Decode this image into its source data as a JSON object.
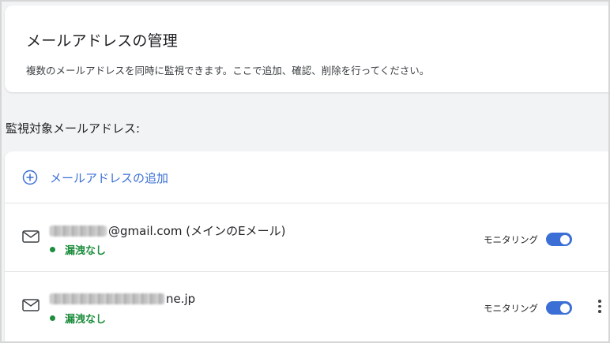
{
  "header": {
    "title": "メールアドレスの管理",
    "description": "複数のメールアドレスを同時に監視できます。ここで追加、確認、削除を行ってください。"
  },
  "section": {
    "heading": "監視対象メールアドレス:"
  },
  "add_button": {
    "label": "メールアドレスの追加",
    "icon": "plus-circle-icon"
  },
  "emails": [
    {
      "address_visible": "@gmail.com (メインのEメール)",
      "status": "漏洩なし",
      "monitor_label": "モニタリング",
      "monitoring": true,
      "icon": "mail-icon"
    },
    {
      "address_visible": "ne.jp",
      "status": "漏洩なし",
      "monitor_label": "モニタリング",
      "monitoring": true,
      "icon": "mail-icon",
      "has_menu": true
    }
  ],
  "colors": {
    "accent": "#3b6fd6",
    "status_ok": "#1e8e3e",
    "background": "#f1f3f4",
    "card": "#ffffff"
  }
}
